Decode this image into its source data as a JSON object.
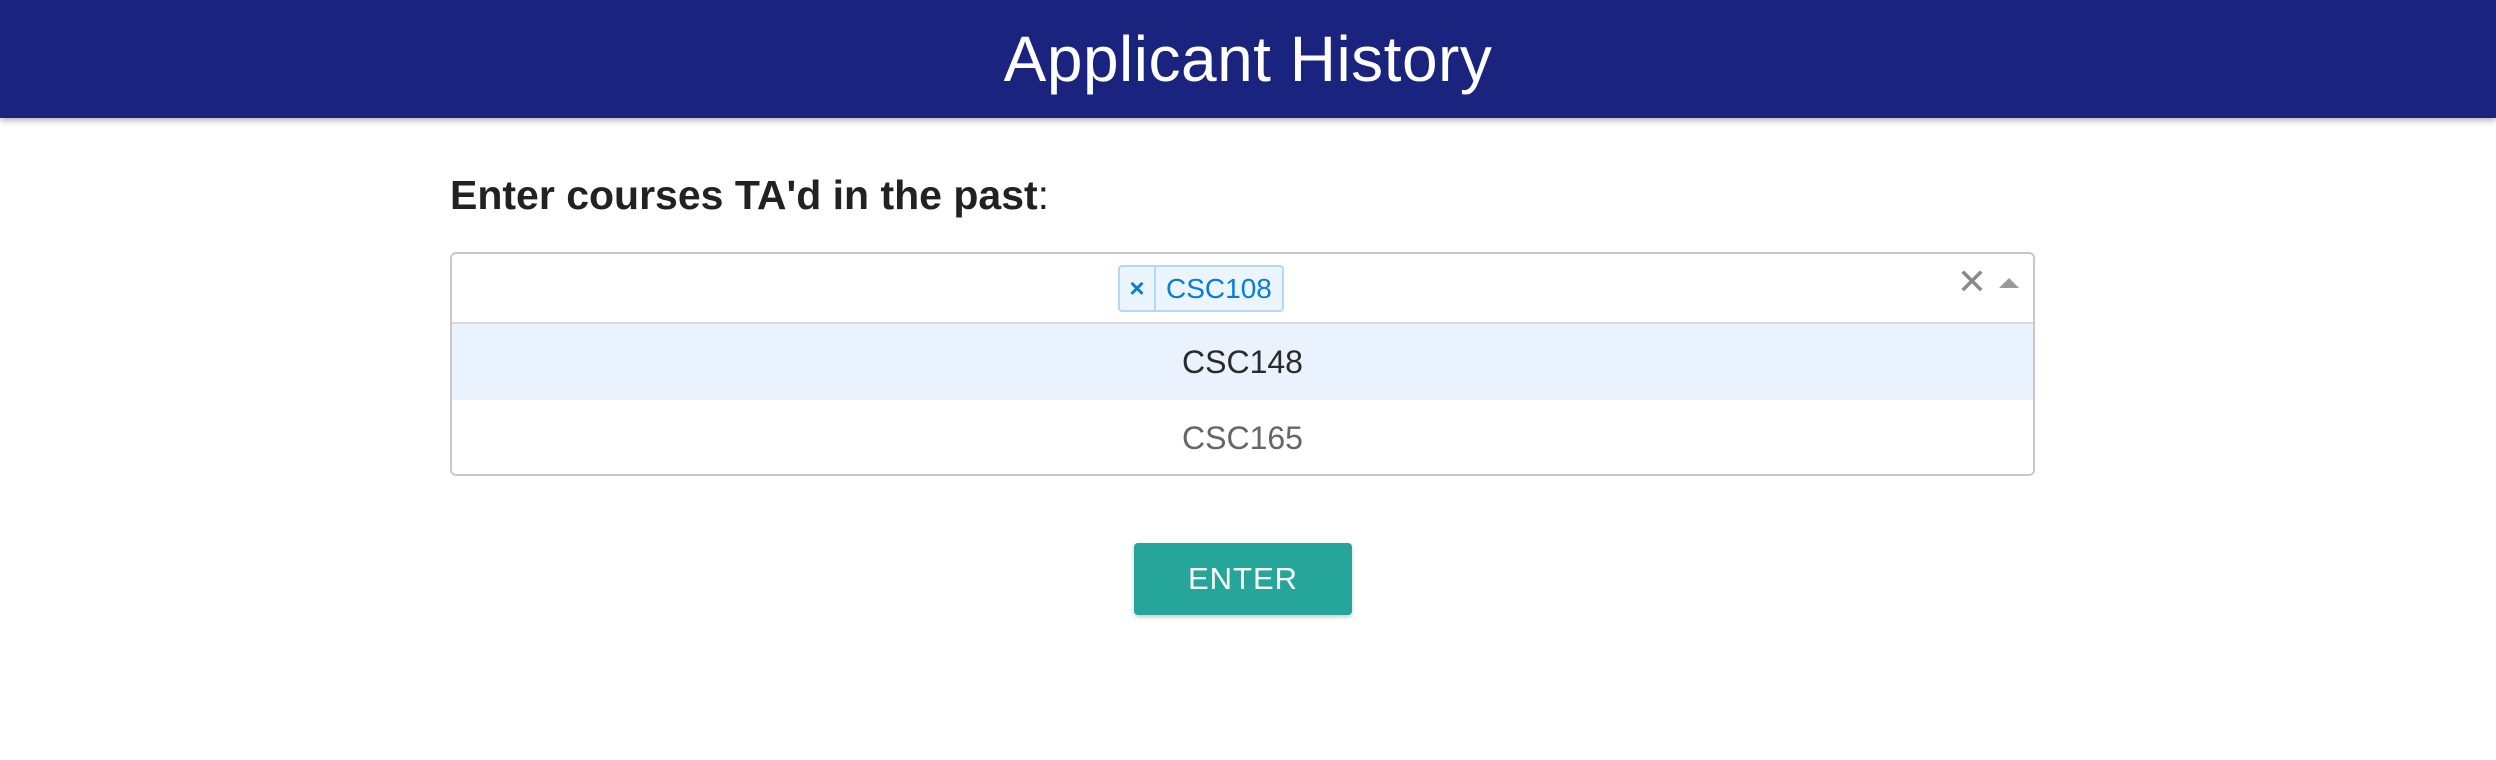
{
  "header": {
    "title": "Applicant History",
    "background_color": "#1a237e"
  },
  "form": {
    "prompt_label": "Enter courses TA'd in the past",
    "prompt_suffix": ":"
  },
  "course_select": {
    "selected_values": [
      {
        "label": "CSC108",
        "remove_symbol": "×"
      }
    ],
    "clear_symbol": "✕",
    "arrow_icon": "caret-up-icon",
    "menu_open": true,
    "options": [
      {
        "label": "CSC148",
        "focused": true
      },
      {
        "label": "CSC165",
        "focused": false
      }
    ],
    "chip_color": "#0a7bd6",
    "focused_option_color": "#eaf3fd"
  },
  "actions": {
    "enter_label": "ENTER",
    "enter_color": "#26a69a"
  }
}
